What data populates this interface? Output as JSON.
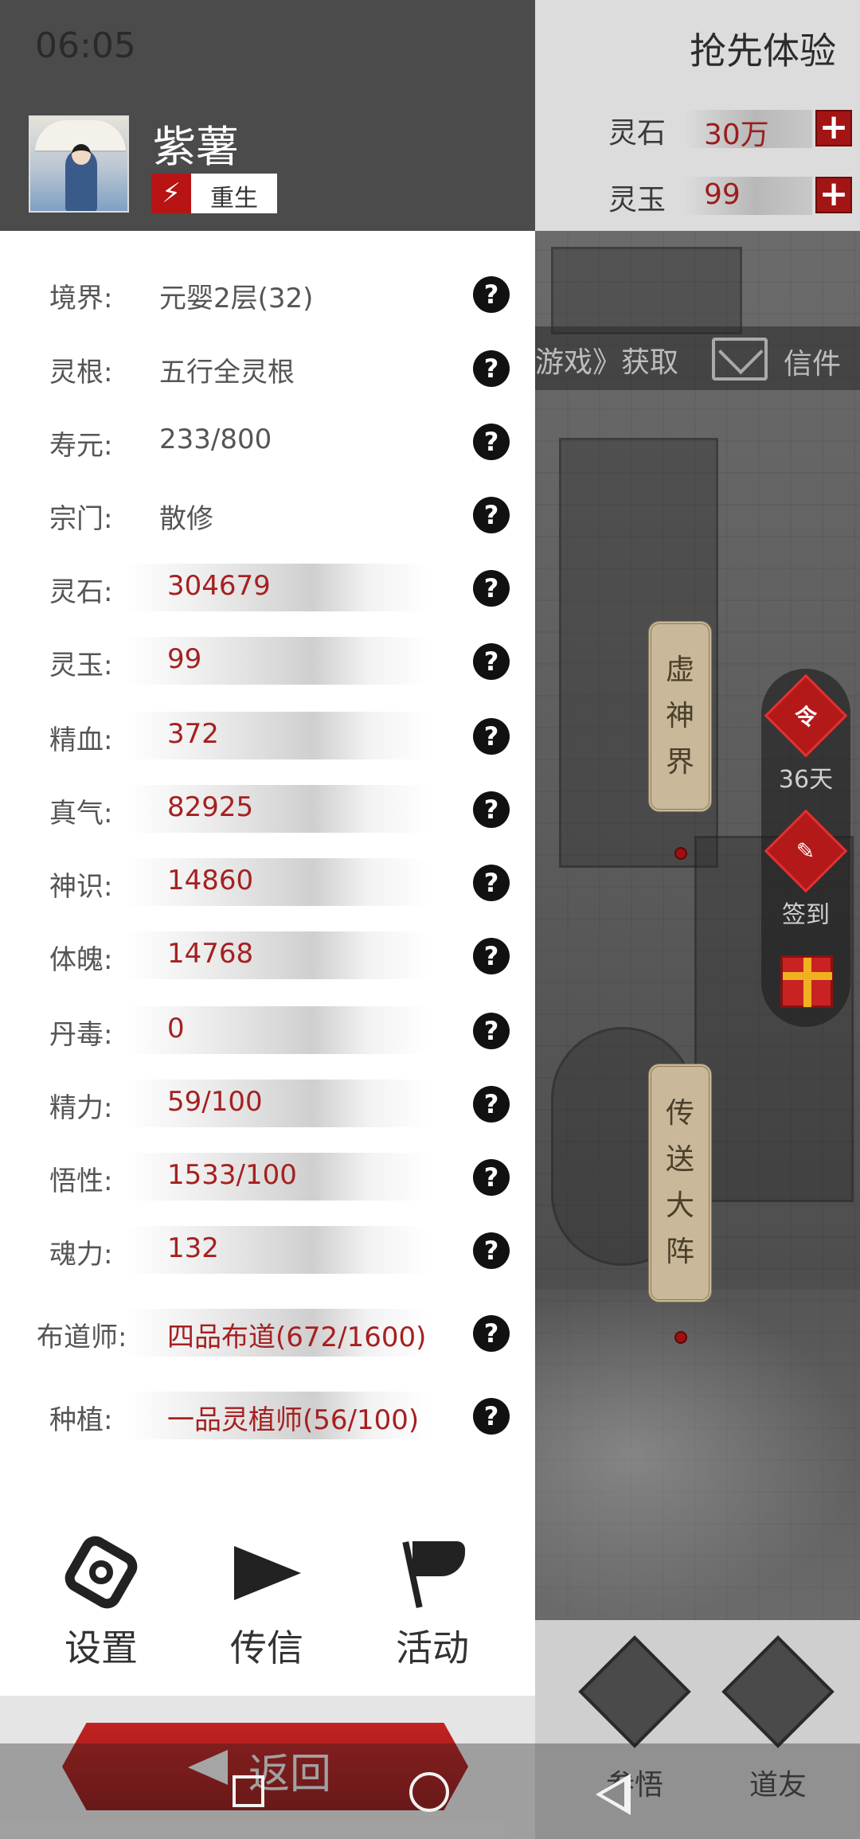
{
  "status_bar": {
    "time": "06:05"
  },
  "player": {
    "name": "紫薯",
    "rebirth_label": "重生"
  },
  "stats": [
    {
      "label": "境界:",
      "value": "元婴2层(32)",
      "style": "plain"
    },
    {
      "label": "灵根:",
      "value": "五行全灵根",
      "style": "plain"
    },
    {
      "label": "寿元:",
      "value": "233/800",
      "style": "plain"
    },
    {
      "label": "宗门:",
      "value": "散修",
      "style": "plain"
    },
    {
      "label": "灵石:",
      "value": "304679",
      "style": "bar"
    },
    {
      "label": "灵玉:",
      "value": "99",
      "style": "bar"
    },
    {
      "label": "精血:",
      "value": "372",
      "style": "bar"
    },
    {
      "label": "真气:",
      "value": "82925",
      "style": "bar"
    },
    {
      "label": "神识:",
      "value": "14860",
      "style": "bar"
    },
    {
      "label": "体魄:",
      "value": "14768",
      "style": "bar"
    },
    {
      "label": "丹毒:",
      "value": "0",
      "style": "bar"
    },
    {
      "label": "精力:",
      "value": "59/100",
      "style": "bar"
    },
    {
      "label": "悟性:",
      "value": "1533/100",
      "style": "bar"
    },
    {
      "label": "魂力:",
      "value": "132",
      "style": "bar"
    },
    {
      "label": "布道师:",
      "value": "四品布道(672/1600)",
      "style": "bar"
    },
    {
      "label": "种植:",
      "value": "一品灵植师(56/100)",
      "style": "bar"
    }
  ],
  "help_glyph": "?",
  "actions": [
    {
      "label": "设置",
      "icon": "gear-icon"
    },
    {
      "label": "传信",
      "icon": "send-icon"
    },
    {
      "label": "活动",
      "icon": "flag-icon"
    }
  ],
  "return_label": "返回",
  "game": {
    "promo_title": "抢先体验",
    "resources": [
      {
        "label": "灵石",
        "value": "30万",
        "plus": "+"
      },
      {
        "label": "灵玉",
        "value": "99",
        "plus": "+"
      }
    ],
    "marquee": "游戏》获取",
    "mail_label": "信件",
    "side": {
      "token_glyph": "令",
      "token_days": "36天",
      "checkin_label": "签到"
    },
    "plaques": [
      {
        "chars": [
          "虚",
          "神",
          "界"
        ]
      },
      {
        "chars": [
          "传",
          "送",
          "大",
          "阵"
        ]
      }
    ],
    "bottom": [
      {
        "label": "参悟"
      },
      {
        "label": "道友"
      }
    ]
  },
  "colors": {
    "accent_red": "#a62020",
    "header_gray": "#4b4b4b",
    "button_red": "#b81414"
  }
}
